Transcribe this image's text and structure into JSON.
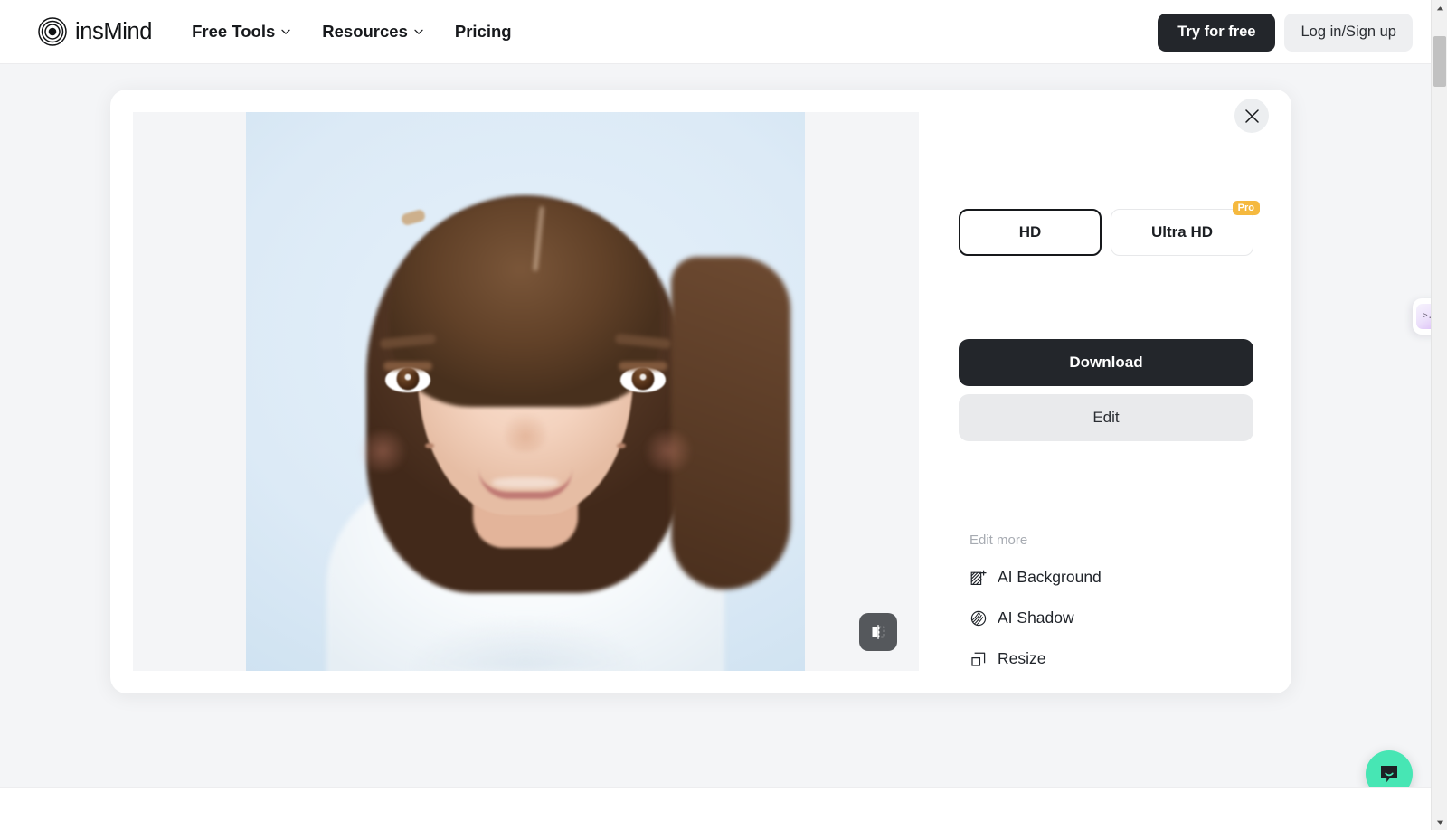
{
  "header": {
    "brand": {
      "name": "insMind",
      "logo_icon": "concentric-circles-logo"
    },
    "nav": [
      {
        "label": "Free Tools",
        "has_dropdown": true,
        "icon": "chevron-down-icon"
      },
      {
        "label": "Resources",
        "has_dropdown": true,
        "icon": "chevron-down-icon"
      },
      {
        "label": "Pricing",
        "has_dropdown": false
      }
    ],
    "actions": {
      "try_label": "Try for free",
      "login_label": "Log in/Sign up"
    }
  },
  "result_card": {
    "close_icon": "close-icon",
    "preview": {
      "image_alt": "Portrait of a smiling young girl with brown bob haircut on a light blue background",
      "compare_icon": "compare-split-icon"
    },
    "quality": {
      "options": [
        {
          "label": "HD",
          "selected": true,
          "badge": null
        },
        {
          "label": "Ultra HD",
          "selected": false,
          "badge": "Pro"
        }
      ]
    },
    "primary_action": "Download",
    "secondary_action": "Edit",
    "edit_more": {
      "title": "Edit more",
      "items": [
        {
          "label": "AI Background",
          "icon": "ai-background-icon"
        },
        {
          "label": "AI Shadow",
          "icon": "ai-shadow-icon"
        },
        {
          "label": "Resize",
          "icon": "resize-icon"
        }
      ]
    }
  },
  "widgets": {
    "feedback": {
      "face": ">.<",
      "icon": "feedback-face-icon"
    },
    "chat": {
      "icon": "chat-bubble-icon"
    }
  },
  "colors": {
    "accent_dark": "#23262b",
    "pro_badge": "#f5b93f",
    "chat_bubble": "#47e6b4",
    "page_bg": "#f4f5f7",
    "light_button": "#e9eaec"
  }
}
